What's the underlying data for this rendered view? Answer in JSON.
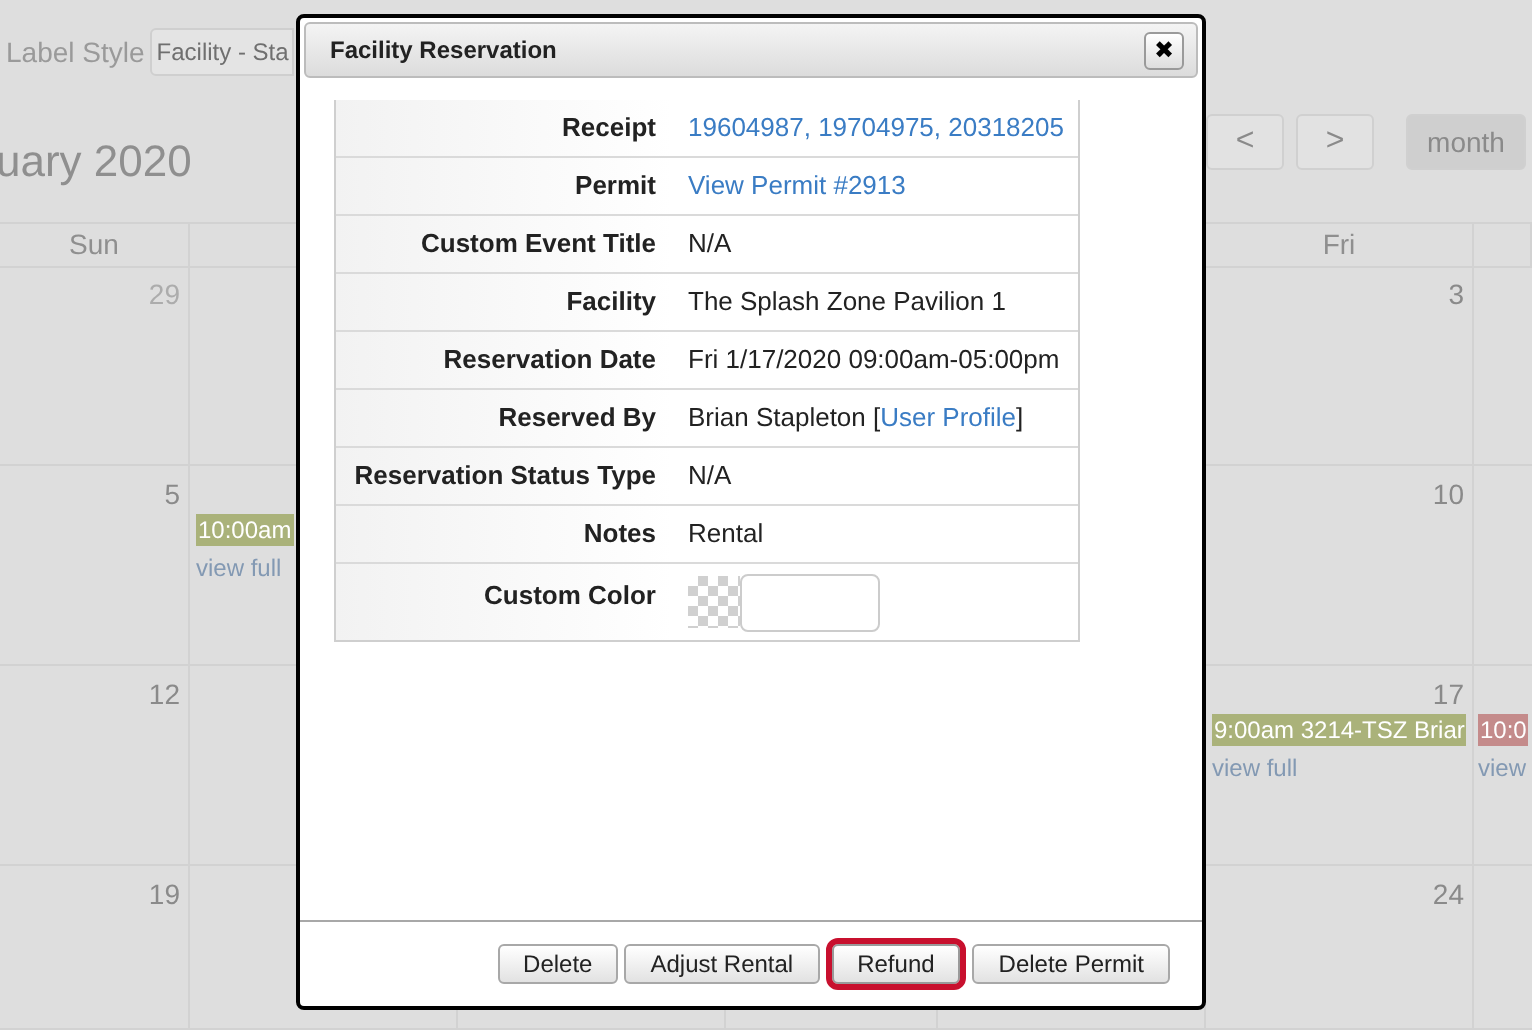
{
  "toolbar": {
    "label_style": {
      "label": "Label Style",
      "value": "Facility - Sta"
    },
    "title": "uary 2020",
    "nav_buttons": [
      "<",
      ">"
    ],
    "view_buttons": [
      {
        "label": "month",
        "selected": true
      }
    ]
  },
  "calendar": {
    "headers": [
      {
        "kind": "sun",
        "text": "Sun"
      },
      {
        "kind": "fri",
        "text": "Fri"
      }
    ],
    "weeks": [
      {
        "cells": [
          {
            "kind": "sun",
            "number": "29",
            "other_month": true
          },
          {
            "kind": "fri",
            "number": "3",
            "other_month": false
          }
        ]
      },
      {
        "cells": [
          {
            "kind": "sun",
            "number": "5",
            "other_month": false
          },
          {
            "kind": "mon",
            "events": [
              {
                "text": "10:00am",
                "color": "#aab27a"
              }
            ],
            "more": "view full"
          },
          {
            "kind": "fri",
            "number": "10",
            "other_month": false
          }
        ]
      },
      {
        "cells": [
          {
            "kind": "sun",
            "number": "12",
            "other_month": false
          },
          {
            "kind": "fri",
            "number": "17",
            "other_month": false,
            "events": [
              {
                "text": "9:00am 3214-TSZ Briar",
                "color": "#aab27a"
              }
            ],
            "more": "view full"
          },
          {
            "kind": "sat",
            "events": [
              {
                "text": "10:0",
                "color": "#c48b8b"
              }
            ],
            "more": "view"
          }
        ]
      },
      {
        "cells": [
          {
            "kind": "sun",
            "number": "19",
            "other_month": false
          },
          {
            "kind": "fri",
            "number": "24",
            "other_month": false
          }
        ]
      }
    ]
  },
  "dialog": {
    "title": "Facility Reservation",
    "close": "✖",
    "fields": [
      {
        "label": "Receipt",
        "kind": "link",
        "value": "19604987, 19704975, 20318205"
      },
      {
        "label": "Permit",
        "kind": "link",
        "value": "View Permit #2913"
      },
      {
        "label": "Custom Event Title",
        "kind": "text",
        "value": "N/A"
      },
      {
        "label": "Facility",
        "kind": "text",
        "value": "The Splash Zone Pavilion 1"
      },
      {
        "label": "Reservation Date",
        "kind": "text",
        "value": "Fri 1/17/2020 09:00am-05:00pm"
      },
      {
        "label": "Reserved By",
        "kind": "parts",
        "parts": [
          {
            "text": "Brian Stapleton [",
            "link": false
          },
          {
            "text": "User Profile",
            "link": true
          },
          {
            "text": "]",
            "link": false
          }
        ]
      },
      {
        "label": "Reservation Status Type",
        "kind": "text",
        "value": "N/A"
      },
      {
        "label": "Notes",
        "kind": "text",
        "value": "Rental"
      },
      {
        "label": "Custom Color",
        "kind": "color"
      }
    ],
    "buttons": [
      {
        "label": "Delete",
        "highlighted": false
      },
      {
        "label": "Adjust Rental",
        "highlighted": false
      },
      {
        "label": "Refund",
        "highlighted": true
      },
      {
        "label": "Delete Permit",
        "highlighted": false
      }
    ]
  }
}
